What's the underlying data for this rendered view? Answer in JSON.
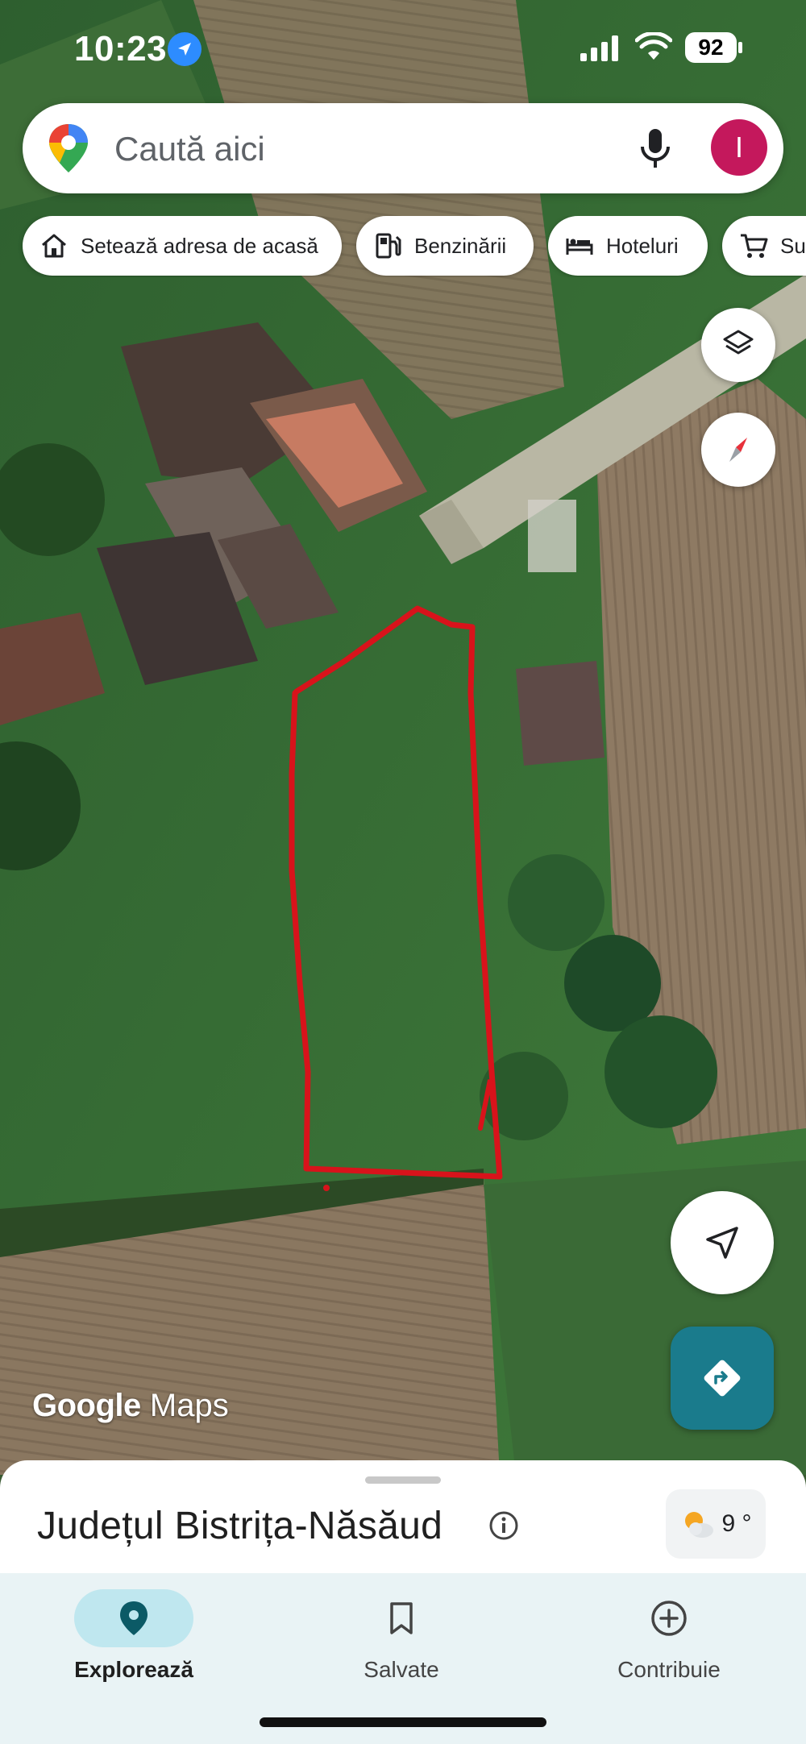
{
  "status_bar": {
    "time": "10:23",
    "battery": "92",
    "location_icon": "location-arrow-icon",
    "signal_icon": "cellular-signal-icon",
    "wifi_icon": "wifi-icon"
  },
  "search": {
    "placeholder": "Caută aici",
    "mic_icon": "microphone-icon",
    "avatar_letter": "I",
    "avatar_color": "#c4185c"
  },
  "chips": [
    {
      "label": "Setează adresa de acasă",
      "icon": "home-icon"
    },
    {
      "label": "Benzinării",
      "icon": "gas-station-icon"
    },
    {
      "label": "Hoteluri",
      "icon": "bed-icon"
    },
    {
      "label": "Su",
      "icon": "shopping-cart-icon"
    }
  ],
  "map": {
    "attribution": {
      "google": "Google",
      "maps": "Maps"
    },
    "overlay_color": "#d8131b",
    "layers_icon": "layers-icon",
    "compass_icon": "compass-icon",
    "my_location_icon": "navigation-arrow-icon",
    "directions_icon": "directions-icon",
    "directions_color": "#1a7b8c"
  },
  "sheet": {
    "title": "Județul Bistrița-Năsăud",
    "info_icon": "info-icon",
    "weather": {
      "temp": "9 °",
      "icon": "partly-cloudy-icon"
    }
  },
  "bottom_nav": {
    "items": [
      {
        "label": "Explorează",
        "icon": "location-pin-icon",
        "active": true
      },
      {
        "label": "Salvate",
        "icon": "bookmark-icon",
        "active": false
      },
      {
        "label": "Contribuie",
        "icon": "add-circle-icon",
        "active": false
      }
    ],
    "active_color": "#bfe7ef"
  }
}
